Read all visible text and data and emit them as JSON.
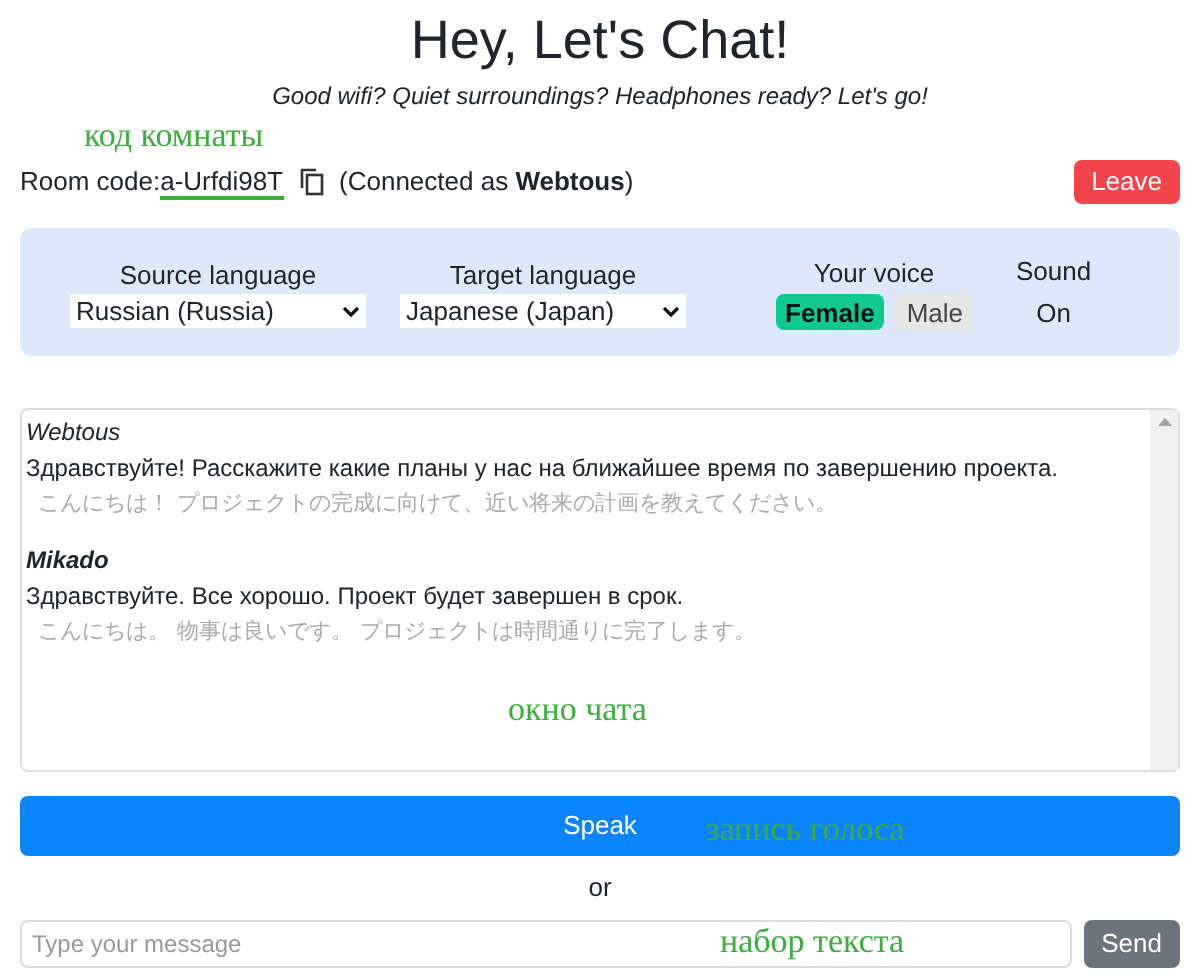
{
  "header": {
    "title": "Hey, Let's Chat!",
    "subtitle": "Good wifi? Quiet surroundings? Headphones ready? Let's go!"
  },
  "room": {
    "label": "Room code:",
    "code": "a-Urfdi98T",
    "connection": "(Connected as **Webtous**)",
    "annotation": "код комнаты",
    "leave": "Leave"
  },
  "settings": {
    "source": {
      "label": "Source language",
      "value": "Russian (Russia)"
    },
    "target": {
      "label": "Target language",
      "value": "Japanese (Japan)"
    },
    "voice": {
      "label": "Your voice",
      "options": [
        {
          "label": "Female",
          "selected": true
        },
        {
          "label": "Male",
          "selected": false
        }
      ]
    },
    "sound": {
      "label": "Sound",
      "value": "On"
    }
  },
  "chat": {
    "annotation": "окно чата",
    "messages": [
      {
        "sender": "Webtous",
        "own": true,
        "text": "Здравствуйте! Расскажите какие планы у нас на ближайшее время по завершению проекта.",
        "translation": "こんにちは！ プロジェクトの完成に向けて、近い将来の計画を教えてください。"
      },
      {
        "sender": "Mikado",
        "own": false,
        "text": "Здравствуйте. Все хорошо. Проект будет завершен в срок.",
        "translation": "こんにちは。 物事は良いです。 プロジェクトは時間通りに完了します。"
      }
    ]
  },
  "speak": {
    "label": "Speak",
    "annotation": "запись голоса"
  },
  "separator": "or",
  "composer": {
    "placeholder": "Type your message",
    "annotation": "набор текста",
    "send": "Send"
  }
}
